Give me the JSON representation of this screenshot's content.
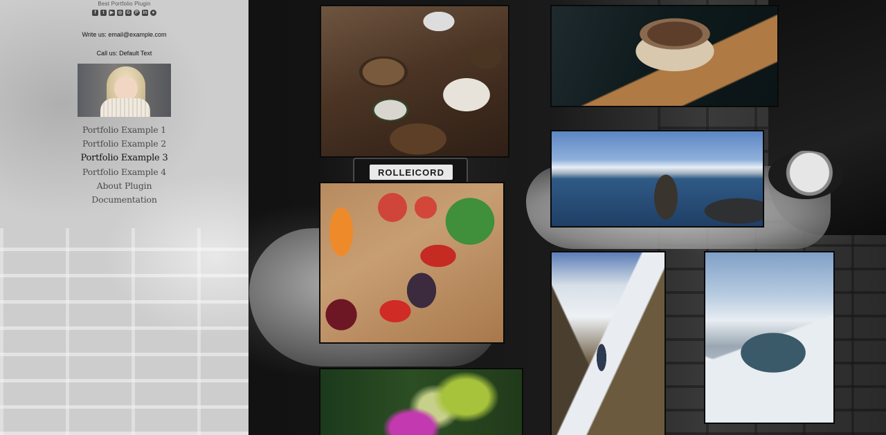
{
  "brand": {
    "tagline": "Best Portfolio Plugin"
  },
  "socials": [
    {
      "icon": "facebook-icon",
      "glyph": "f"
    },
    {
      "icon": "twitter-icon",
      "glyph": "t"
    },
    {
      "icon": "youtube-icon",
      "glyph": "▶"
    },
    {
      "icon": "instagram-icon",
      "glyph": "◎"
    },
    {
      "icon": "google-plus-icon",
      "glyph": "G"
    },
    {
      "icon": "pinterest-icon",
      "glyph": "P"
    },
    {
      "icon": "linkedin-icon",
      "glyph": "in"
    },
    {
      "icon": "github-icon",
      "glyph": "●"
    }
  ],
  "contact": {
    "write_us": "Write us: email@example.com",
    "call_us": "Call us: Default Text"
  },
  "menu": [
    {
      "label": "Portfolio Example 1",
      "active": false
    },
    {
      "label": "Portfolio Example 2",
      "active": false
    },
    {
      "label": "Portfolio Example 3",
      "active": true
    },
    {
      "label": "Portfolio Example 4",
      "active": false
    },
    {
      "label": "About Plugin",
      "active": false
    },
    {
      "label": "Documentation",
      "active": false
    }
  ],
  "background": {
    "camera_label": "ROLLEICORD"
  },
  "colors": {
    "sidebar_bg": "#cdcdcd",
    "page_bg": "#0b0b0b",
    "menu_text": "#4b4b4b",
    "menu_active": "#111111"
  }
}
